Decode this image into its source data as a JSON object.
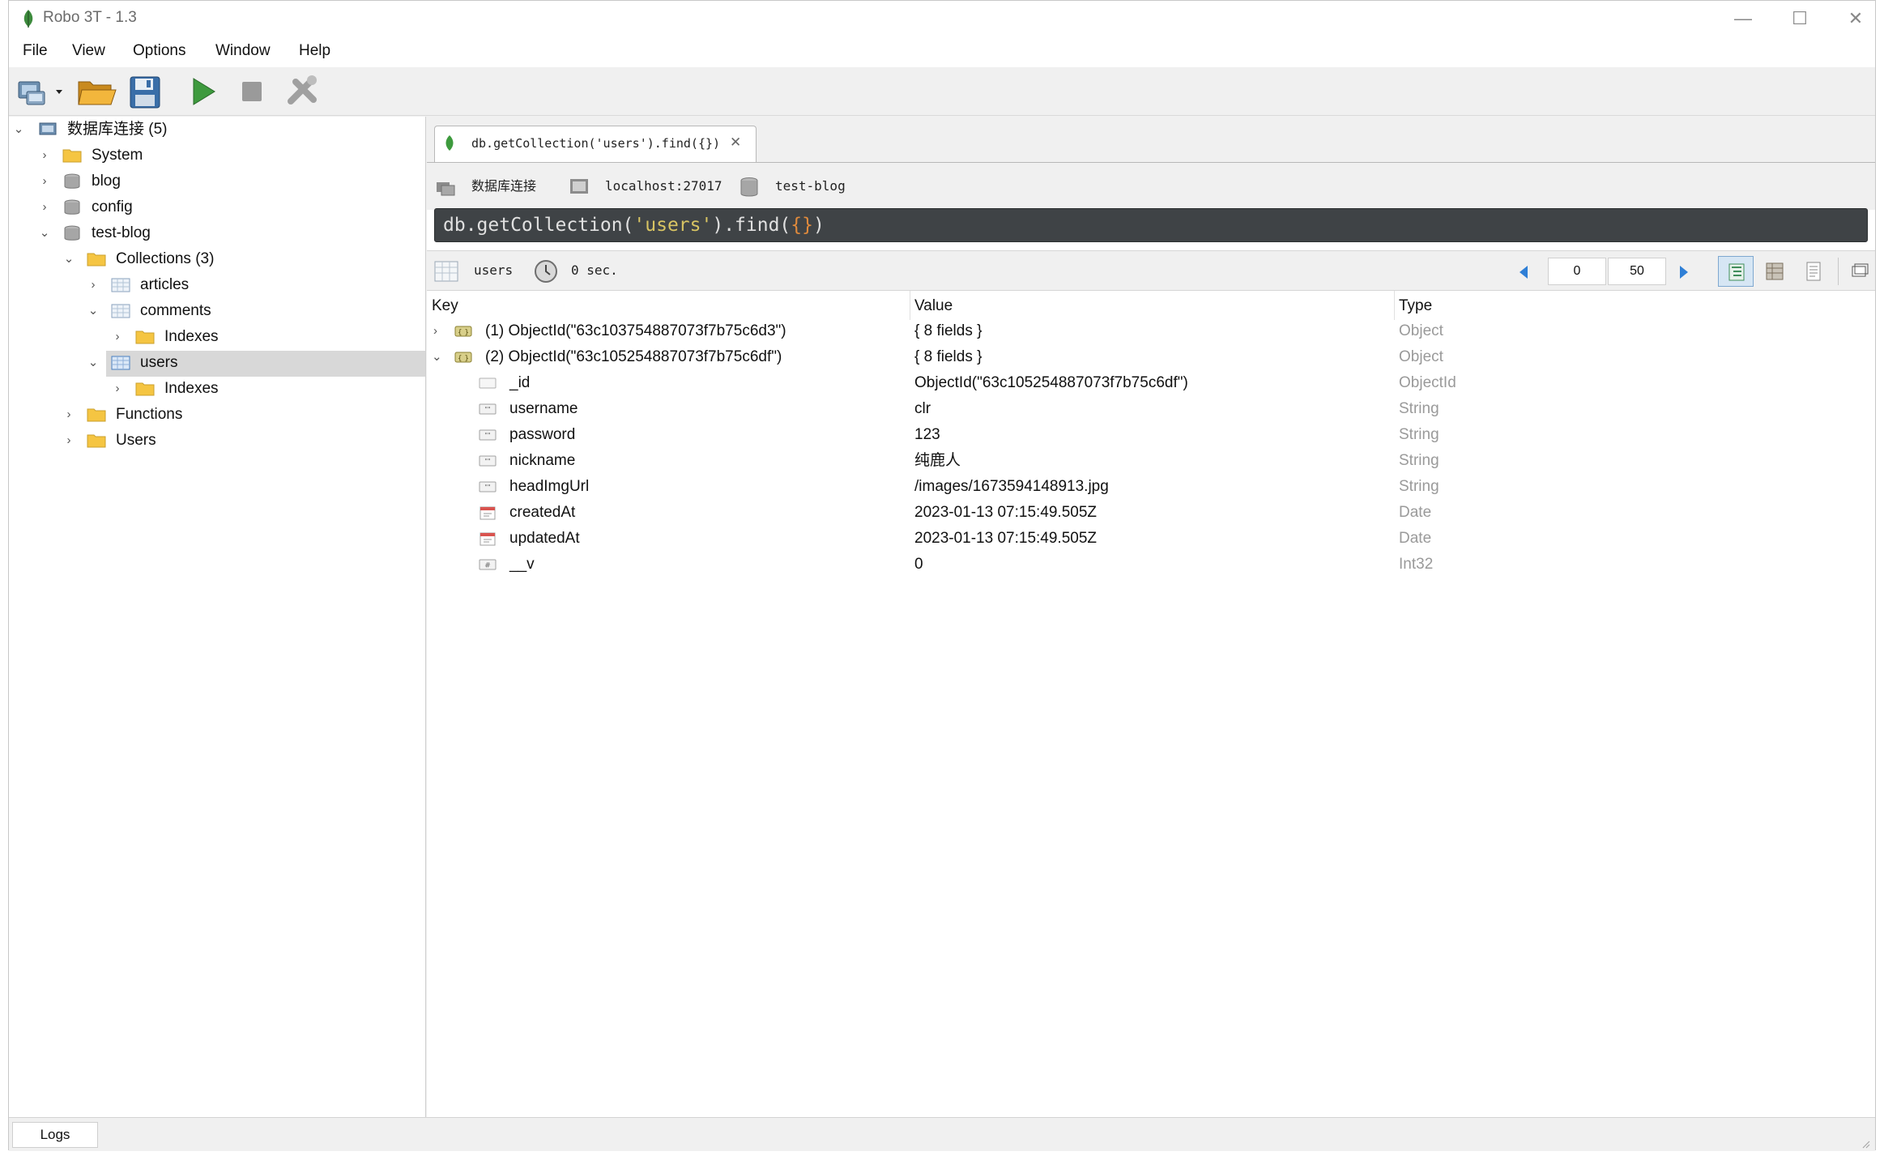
{
  "window": {
    "title": "Robo 3T - 1.3"
  },
  "menu": [
    "File",
    "View",
    "Options",
    "Window",
    "Help"
  ],
  "tree": {
    "root": "数据库连接 (5)",
    "nodes": [
      "System",
      "blog",
      "config",
      "test-blog",
      "Collections (3)",
      "articles",
      "comments",
      "Indexes",
      "users",
      "Indexes",
      "Functions",
      "Users"
    ]
  },
  "tab": {
    "label": "db.getCollection('users').find({})",
    "close": "✕"
  },
  "connection": {
    "name": "数据库连接",
    "server": "localhost:27017",
    "database": "test-blog"
  },
  "query": {
    "prefix": "db.getCollection(",
    "str": "'users'",
    "mid": ").find(",
    "brace": "{}",
    "suffix": ")"
  },
  "result": {
    "collection": "users",
    "time": "0 sec.",
    "skip": "0",
    "limit": "50"
  },
  "grid": {
    "columns": [
      "Key",
      "Value",
      "Type"
    ],
    "rows": [
      {
        "key": "(1) ObjectId(\"63c103754887073f7b75c6d3\")",
        "value": "{ 8 fields }",
        "type": "Object"
      },
      {
        "key": "(2) ObjectId(\"63c105254887073f7b75c6df\")",
        "value": "{ 8 fields }",
        "type": "Object"
      },
      {
        "key": "_id",
        "value": "ObjectId(\"63c105254887073f7b75c6df\")",
        "type": "ObjectId"
      },
      {
        "key": "username",
        "value": "clr",
        "type": "String"
      },
      {
        "key": "password",
        "value": "123",
        "type": "String"
      },
      {
        "key": "nickname",
        "value": "纯鹿人",
        "type": "String"
      },
      {
        "key": "headImgUrl",
        "value": "/images/1673594148913.jpg",
        "type": "String"
      },
      {
        "key": "createdAt",
        "value": "2023-01-13 07:15:49.505Z",
        "type": "Date"
      },
      {
        "key": "updatedAt",
        "value": "2023-01-13 07:15:49.505Z",
        "type": "Date"
      },
      {
        "key": "__v",
        "value": "0",
        "type": "Int32"
      }
    ]
  },
  "status": {
    "logs": "Logs"
  },
  "colors": {
    "query_bg": "#3f4346",
    "selected": "#d8d8d8",
    "accent": "#2f7fd6"
  }
}
